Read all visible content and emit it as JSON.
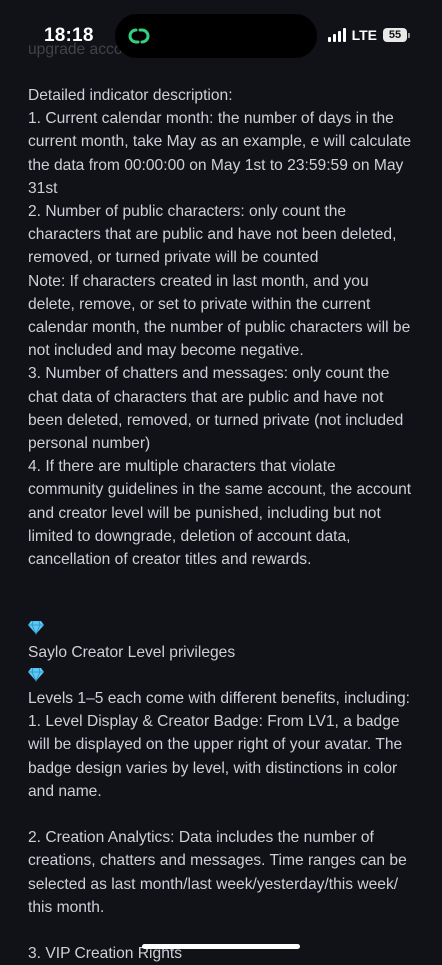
{
  "status_bar": {
    "time": "18:18",
    "network": "LTE",
    "battery": "55"
  },
  "article": {
    "cut_line": "upgrade according to the ... supported",
    "heading_indicators": "Detailed indicator description:",
    "item1": "1. Current calendar month: the number of days in the current month, take May as an example, e will calculate the data from 00:00:00 on May 1st to 23:59:59 on May 31st",
    "item2": "2. Number of public characters: only count the characters that are public and have not been deleted, removed, or turned private will be counted",
    "note": "Note: If characters created in last month, and you delete, remove, or set to private within the current calendar month, the number of public characters will be not included and may become negative.",
    "item3": "3. Number of chatters and messages: only count the chat data of characters that are public and have not been deleted, removed, or turned private (not included personal number)",
    "item4": "4. If there are multiple characters that violate community guidelines in the same account, the account and creator level will be punished, including but not limited to downgrade, deletion of account data, cancellation of creator titles and rewards.",
    "privileges_title": "Saylo Creator Level privileges",
    "privileges_intro": "Levels 1–5 each come with different benefits, including:",
    "privilege1": "1. Level Display & Creator Badge: From LV1, a badge will be displayed on the upper right of your avatar. The badge design varies by level, with distinctions in color and name.",
    "privilege2": "2. Creation Analytics: Data includes the number of creations, chatters and messages. Time ranges can be selected as last month/last week/yesterday/this week/ this month.",
    "privilege3": "3. VIP Creation Rights"
  },
  "icons": {
    "island": "link-app-icon",
    "gem": "gem-icon"
  },
  "colors": {
    "background": "#111118",
    "text": "#cfcfd6",
    "island_icon": "#35d07f",
    "gem": "#5bc8f5"
  }
}
